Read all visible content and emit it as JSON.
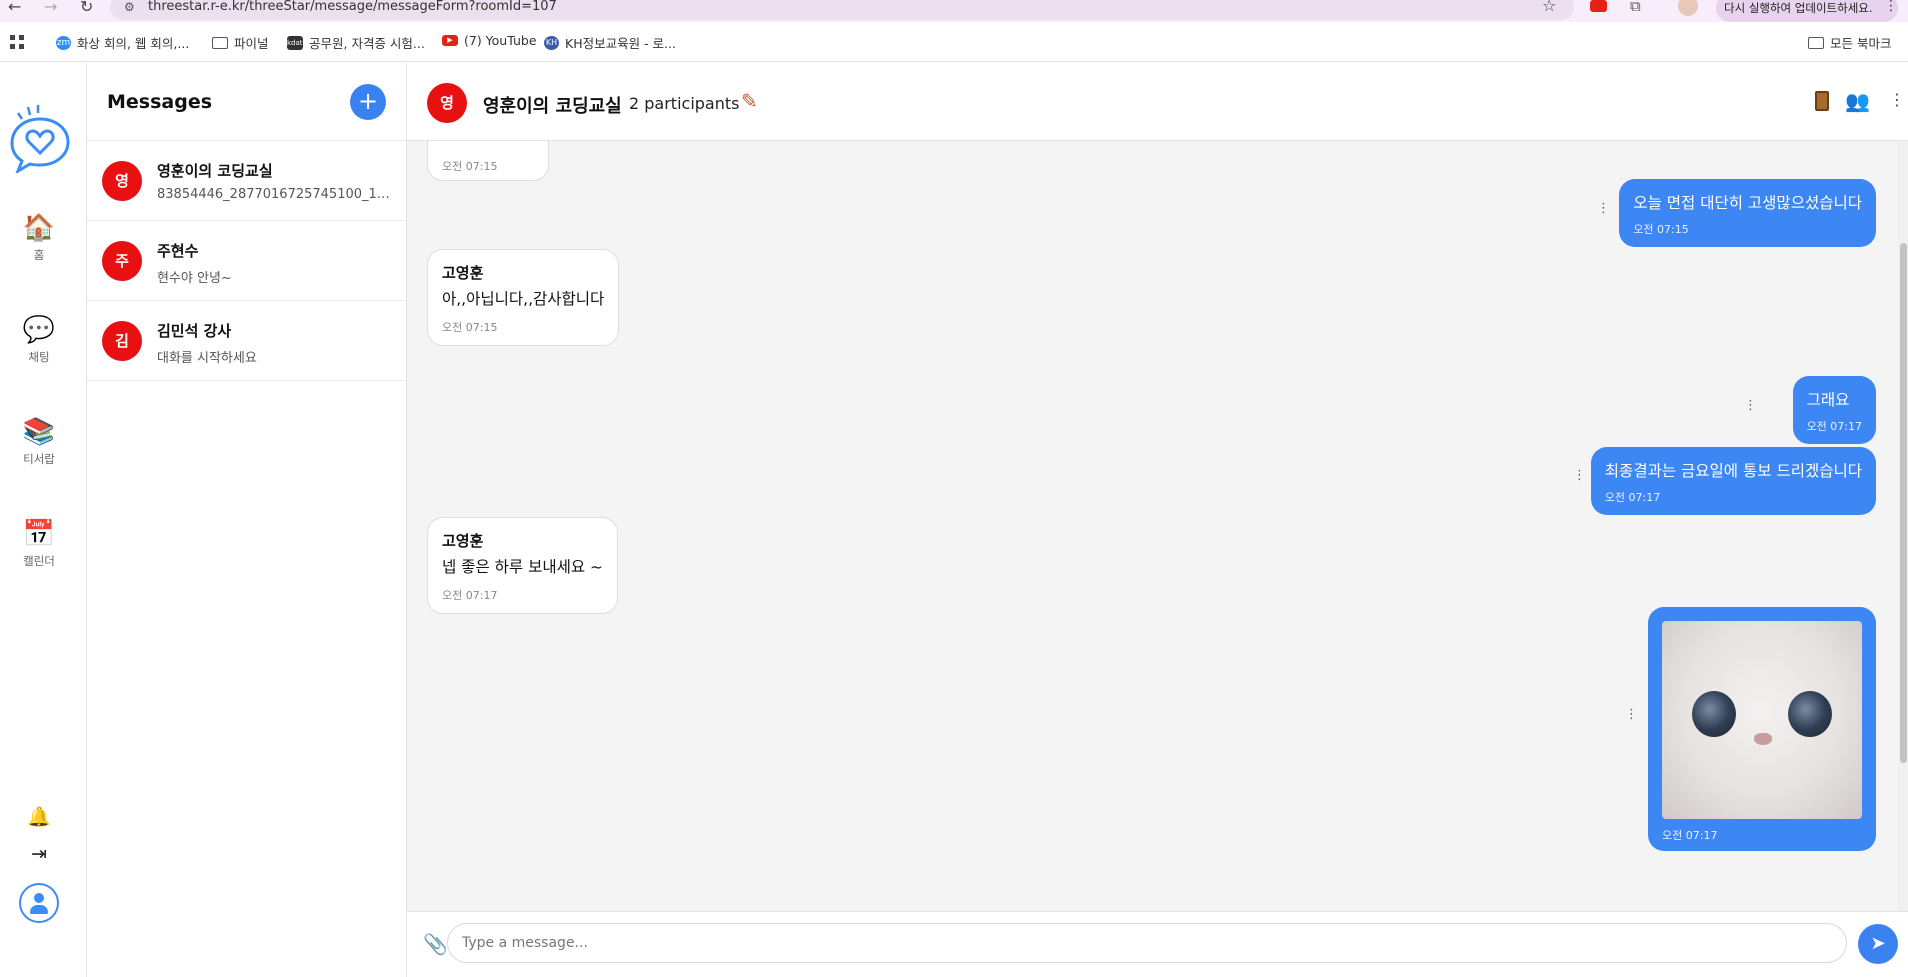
{
  "browser": {
    "url": "threestar.r-e.kr/threeStar/message/messageForm?roomId=107",
    "update_button": "다시 실행하여 업데이트하세요.",
    "bookmarks": [
      {
        "icon": "zoom",
        "label": "화상 회의, 웹 회의,..."
      },
      {
        "icon": "folder",
        "label": "파이널"
      },
      {
        "icon": "kdata",
        "label": "공무원, 자격증 시험..."
      },
      {
        "icon": "youtube",
        "label": "(7) YouTube"
      },
      {
        "icon": "kh",
        "label": "KH정보교육원 - 로..."
      }
    ],
    "all_bookmarks": "모든 북마크"
  },
  "rail": {
    "items": [
      {
        "icon": "home-icon",
        "label": "홈"
      },
      {
        "icon": "chat-icon",
        "label": "채팅"
      },
      {
        "icon": "books-icon",
        "label": "티서랍"
      },
      {
        "icon": "calendar-icon",
        "label": "캘린더"
      }
    ]
  },
  "conversations": {
    "title": "Messages",
    "new_button": "+",
    "items": [
      {
        "initial": "영",
        "name": "영훈이의 코딩교실",
        "preview": "83854446_2877016725745100_1763..."
      },
      {
        "initial": "주",
        "name": "주현수",
        "preview": "현수야 안녕~"
      },
      {
        "initial": "김",
        "name": "김민석 강사",
        "preview": "대화를 시작하세요"
      }
    ]
  },
  "chat": {
    "initial": "영",
    "title": "영훈이의 코딩교실",
    "participants": "2 participants",
    "messages": [
      {
        "type": "in",
        "sender": "",
        "text": "",
        "time": "오전 07:15"
      },
      {
        "type": "out",
        "text": "오늘 면접 대단히 고생많으셨습니다",
        "time": "오전 07:15"
      },
      {
        "type": "in",
        "sender": "고영훈",
        "text": "아,,아닙니다,,감사합니다",
        "time": "오전 07:15"
      },
      {
        "type": "out",
        "text": "그래요",
        "time": "오전 07:17"
      },
      {
        "type": "out",
        "text": "최종결과는 금요일에 통보 드리겠습니다",
        "time": "오전 07:17"
      },
      {
        "type": "in",
        "sender": "고영훈",
        "text": "넵 좋은 하루 보내세요 ~",
        "time": "오전 07:17"
      },
      {
        "type": "out-image",
        "image": "kitten-photo",
        "time": "오전 07:17"
      }
    ],
    "input_placeholder": "Type a message..."
  },
  "colors": {
    "accent": "#3d87f5",
    "avatar": "#e81010"
  }
}
